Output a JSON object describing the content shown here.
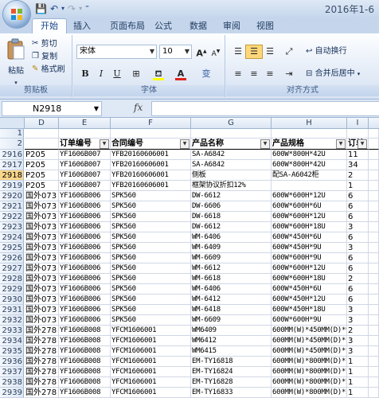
{
  "title_bar": {
    "title": "2016年1-6"
  },
  "tabs": [
    "开始",
    "插入",
    "页面布局",
    "公式",
    "数据",
    "审阅",
    "视图"
  ],
  "ribbon": {
    "clipboard": {
      "paste": "粘贴",
      "cut": "剪切",
      "copy": "复制",
      "format_painter": "格式刷",
      "label": "剪贴板"
    },
    "font": {
      "font_name": "宋体",
      "font_size": "10",
      "label": "字体",
      "bold": "B",
      "italic": "I",
      "underline": "U",
      "grow": "A",
      "shrink": "A",
      "font_color_glyph": "A",
      "phonetic": "变"
    },
    "alignment": {
      "wrap_text": "自动换行",
      "merge_center": "合并后居中",
      "label": "对齐方式"
    }
  },
  "formula_bar": {
    "name_box": "N2918",
    "fx": "fx",
    "value": ""
  },
  "columns": [
    "D",
    "E",
    "F",
    "G",
    "H",
    "I"
  ],
  "header_row": {
    "row": "2",
    "cells": [
      "",
      "订单编号",
      "合同编号",
      "产品名称",
      "产品规格",
      "订单"
    ]
  },
  "blank_row": "1",
  "rows": [
    {
      "n": "2916",
      "d": "P205",
      "e": "YF1606B007",
      "f": "YFB20160606001",
      "g": "SA-A6842",
      "h": "600W*800H*42U",
      "i": "11"
    },
    {
      "n": "2917",
      "d": "P205",
      "e": "YF1606B007",
      "f": "YFB20160606001",
      "g": "SA-A6842",
      "h": "600W*800H*42U",
      "i": "34"
    },
    {
      "n": "2918",
      "d": "P205",
      "e": "YF1606B007",
      "f": "YFB20160606001",
      "g": "侧板",
      "h": "配SA-A6042柜",
      "i": "2"
    },
    {
      "n": "2919",
      "d": "P205",
      "e": "YF1606B007",
      "f": "YFB20160606001",
      "g": "框架协议折扣12%",
      "h": "",
      "i": "1"
    },
    {
      "n": "2920",
      "d": "国外073",
      "e": "YF1606B006",
      "f": "SPK560",
      "g": "DW-6612",
      "h": "600W*600H*12U",
      "i": "6"
    },
    {
      "n": "2921",
      "d": "国外073",
      "e": "YF1606B006",
      "f": "SPK560",
      "g": "DW-6606",
      "h": "600W*600H*6U",
      "i": "6"
    },
    {
      "n": "2922",
      "d": "国外073",
      "e": "YF1606B006",
      "f": "SPK560",
      "g": "DW-6618",
      "h": "600W*600H*12U",
      "i": "6"
    },
    {
      "n": "2923",
      "d": "国外073",
      "e": "YF1606B006",
      "f": "SPK560",
      "g": "DW-6612",
      "h": "600W*600H*18U",
      "i": "3"
    },
    {
      "n": "2924",
      "d": "国外073",
      "e": "YF1606B006",
      "f": "SPK560",
      "g": "WM-6406",
      "h": "600W*450H*6U",
      "i": "6"
    },
    {
      "n": "2925",
      "d": "国外073",
      "e": "YF1606B006",
      "f": "SPK560",
      "g": "WM-6409",
      "h": "600W*450H*9U",
      "i": "3"
    },
    {
      "n": "2926",
      "d": "国外073",
      "e": "YF1606B006",
      "f": "SPK560",
      "g": "WM-6609",
      "h": "600W*600H*9U",
      "i": "6"
    },
    {
      "n": "2927",
      "d": "国外073",
      "e": "YF1606B006",
      "f": "SPK560",
      "g": "WM-6612",
      "h": "600W*600H*12U",
      "i": "6"
    },
    {
      "n": "2928",
      "d": "国外073",
      "e": "YF1606B006",
      "f": "SPK560",
      "g": "WM-6618",
      "h": "600W*600H*18U",
      "i": "2"
    },
    {
      "n": "2929",
      "d": "国外073",
      "e": "YF1606B006",
      "f": "SPK560",
      "g": "WM-6406",
      "h": "600W*450H*6U",
      "i": "6"
    },
    {
      "n": "2930",
      "d": "国外073",
      "e": "YF1606B006",
      "f": "SPK560",
      "g": "WM-6412",
      "h": "600W*450H*12U",
      "i": "6"
    },
    {
      "n": "2931",
      "d": "国外073",
      "e": "YF1606B006",
      "f": "SPK560",
      "g": "WM-6418",
      "h": "600W*450H*18U",
      "i": "3"
    },
    {
      "n": "2932",
      "d": "国外073",
      "e": "YF1606B006",
      "f": "SPK560",
      "g": "WM-6609",
      "h": "600W*600H*9U",
      "i": "3"
    },
    {
      "n": "2933",
      "d": "国外278",
      "e": "YF1606B008",
      "f": "YFCM1606001",
      "g": "WM6409",
      "h": "600MM(W)*450MM(D)*9",
      "i": "2"
    },
    {
      "n": "2934",
      "d": "国外278",
      "e": "YF1606B008",
      "f": "YFCM1606001",
      "g": "WM6412",
      "h": "600MM(W)*450MM(D)*1",
      "i": "3"
    },
    {
      "n": "2935",
      "d": "国外278",
      "e": "YF1606B008",
      "f": "YFCM1606001",
      "g": "WM6415",
      "h": "600MM(W)*450MM(D)*1",
      "i": "3"
    },
    {
      "n": "2936",
      "d": "国外278",
      "e": "YF1606B008",
      "f": "YFCM1606001",
      "g": "EM-TY16818",
      "h": "600MM(W)*800MM(D)*1",
      "i": "1"
    },
    {
      "n": "2937",
      "d": "国外278",
      "e": "YF1606B008",
      "f": "YFCM1606001",
      "g": "EM-TY16824",
      "h": "600MM(W)*800MM(D)*2",
      "i": "1"
    },
    {
      "n": "2938",
      "d": "国外278",
      "e": "YF1606B008",
      "f": "YFCM1606001",
      "g": "EM-TY16828",
      "h": "600MM(W)*800MM(D)*2",
      "i": "1"
    },
    {
      "n": "2939",
      "d": "国外278",
      "e": "YF1606B008",
      "f": "YFCM1606001",
      "g": "EM-TY16833",
      "h": "600MM(W)*800MM(D)*3",
      "i": "1"
    }
  ],
  "colors": {
    "selected_row": "#f9d68a",
    "header_bg": "#dbe6f4",
    "ribbon_bg": "#e4ecf7"
  }
}
